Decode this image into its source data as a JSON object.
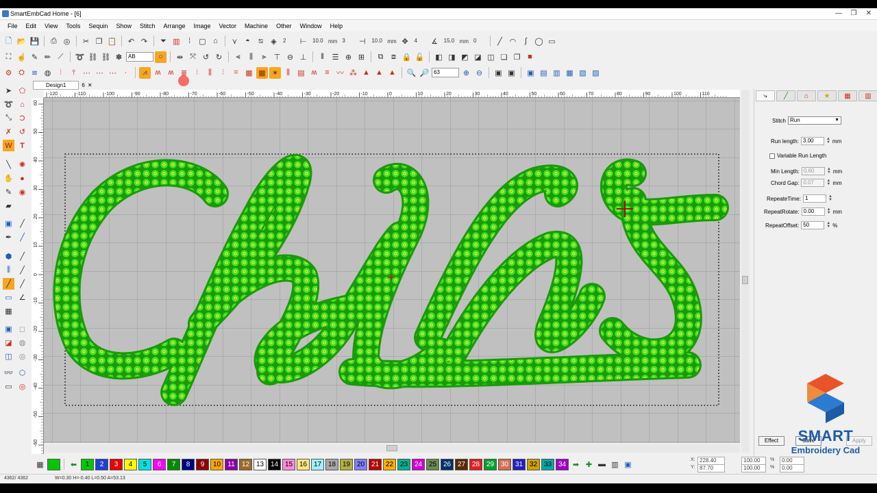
{
  "window": {
    "title": "SmartEmbCad Home - [6]",
    "controls": [
      "—",
      "❐",
      "✕"
    ]
  },
  "menu": [
    "File",
    "Edit",
    "View",
    "Tools",
    "Sequin",
    "Show",
    "Stitch",
    "Arrange",
    "Image",
    "Vector",
    "Machine",
    "Other",
    "Window",
    "Help"
  ],
  "toolbar1": {
    "val1": "2",
    "val2": "10.0",
    "unit_mm": "mm",
    "val3": "3",
    "val4": "10.0",
    "val5": "4",
    "val6": "15.0",
    "val7": "0"
  },
  "toolbar2": {
    "combo": "AB"
  },
  "toolbar3": {
    "zoom": "63"
  },
  "document": {
    "tab_name": "Design1",
    "tab_num": "6",
    "close": "✕"
  },
  "ruler": {
    "h_ticks": [
      "-120",
      "-110",
      "-100",
      "-90",
      "-80",
      "-70",
      "-60",
      "-50",
      "-40",
      "-30",
      "-20",
      "-10",
      "0",
      "10",
      "20",
      "30",
      "40",
      "50",
      "60",
      "70",
      "80",
      "90",
      "100",
      "110"
    ],
    "v_ticks": [
      "60",
      "50",
      "40",
      "30",
      "20",
      "10",
      "0",
      "-10",
      "-20",
      "-30",
      "-40",
      "-50",
      "-60"
    ]
  },
  "design_text": "Chalkis",
  "panel": {
    "tabs": [
      "stitch-tab",
      "line-tab",
      "house-tab",
      "star-tab",
      "grid-tab",
      "pattern-tab"
    ],
    "stitch_label": "Stitch",
    "stitch_value": "Run",
    "run_length_label": "Run length:",
    "run_length": "3.00",
    "mm": "mm",
    "variable_label": "Variable Run Length",
    "min_length_label": "Min Length:",
    "min_length": "0.60",
    "chord_gap_label": "Chord Gap:",
    "chord_gap": "0.07",
    "repeat_time_label": "RepeateTime:",
    "repeat_time": "1",
    "repeat_rotate_label": "RepeatRotate:",
    "repeat_rotate": "0.00",
    "repeat_offset_label": "RepeatOffset:",
    "repeat_offset": "50",
    "percent": "%",
    "effect": "Effect",
    "save": "Save",
    "apply": "Apply"
  },
  "logo": {
    "brand": "SMART",
    "sub": "Embroidery Cad",
    "colors": [
      "#e8542a",
      "#2b7bd1",
      "#1d5ba6"
    ]
  },
  "palette": [
    {
      "label": "1",
      "color": "#00c800",
      "fg": "#000"
    },
    {
      "label": "2",
      "color": "#1f3fd6",
      "fg": "#fff"
    },
    {
      "label": "3",
      "color": "#e60000",
      "fg": "#fff"
    },
    {
      "label": "4",
      "color": "#ffff00",
      "fg": "#000"
    },
    {
      "label": "5",
      "color": "#00e0e0",
      "fg": "#000"
    },
    {
      "label": "6",
      "color": "#ff00ff",
      "fg": "#fff"
    },
    {
      "label": "7",
      "color": "#008a00",
      "fg": "#fff"
    },
    {
      "label": "8",
      "color": "#000080",
      "fg": "#fff"
    },
    {
      "label": "9",
      "color": "#900000",
      "fg": "#fff"
    },
    {
      "label": "10",
      "color": "#ffa500",
      "fg": "#000"
    },
    {
      "label": "11",
      "color": "#8a00a8",
      "fg": "#fff"
    },
    {
      "label": "12",
      "color": "#9a6a2a",
      "fg": "#fff"
    },
    {
      "label": "13",
      "color": "#ffffff",
      "fg": "#000"
    },
    {
      "label": "14",
      "color": "#000000",
      "fg": "#fff"
    },
    {
      "label": "15",
      "color": "#ff8ad8",
      "fg": "#000"
    },
    {
      "label": "16",
      "color": "#ffe680",
      "fg": "#000"
    },
    {
      "label": "17",
      "color": "#a0f0ff",
      "fg": "#000"
    },
    {
      "label": "18",
      "color": "#a8a8a8",
      "fg": "#000"
    },
    {
      "label": "19",
      "color": "#b0b040",
      "fg": "#000"
    },
    {
      "label": "20",
      "color": "#8080ff",
      "fg": "#000"
    },
    {
      "label": "21",
      "color": "#b80000",
      "fg": "#fff"
    },
    {
      "label": "22",
      "color": "#ffb000",
      "fg": "#000"
    },
    {
      "label": "23",
      "color": "#00b090",
      "fg": "#000"
    },
    {
      "label": "24",
      "color": "#d000d0",
      "fg": "#fff"
    },
    {
      "label": "25",
      "color": "#6a8a50",
      "fg": "#000"
    },
    {
      "label": "26",
      "color": "#00306a",
      "fg": "#fff"
    },
    {
      "label": "27",
      "color": "#5a2a00",
      "fg": "#fff"
    },
    {
      "label": "28",
      "color": "#e02020",
      "fg": "#fff"
    },
    {
      "label": "29",
      "color": "#00a030",
      "fg": "#fff"
    },
    {
      "label": "30",
      "color": "#d07050",
      "fg": "#fff"
    },
    {
      "label": "31",
      "color": "#2020c0",
      "fg": "#fff"
    },
    {
      "label": "32",
      "color": "#d0a000",
      "fg": "#000"
    },
    {
      "label": "33",
      "color": "#00a8a8",
      "fg": "#000"
    },
    {
      "label": "34",
      "color": "#a000c0",
      "fg": "#fff"
    }
  ],
  "coords": {
    "x_label": "X:",
    "x": "228.40",
    "y_label": "Y:",
    "y": "87.70",
    "sx": "100.00",
    "sy": "100.00",
    "pct": "%",
    "a": "0.00",
    "b": "0.00"
  },
  "status": {
    "count": "4362/ 4362",
    "info": "W=0.30 H=-0.40 L=0.50 A=53.13"
  }
}
